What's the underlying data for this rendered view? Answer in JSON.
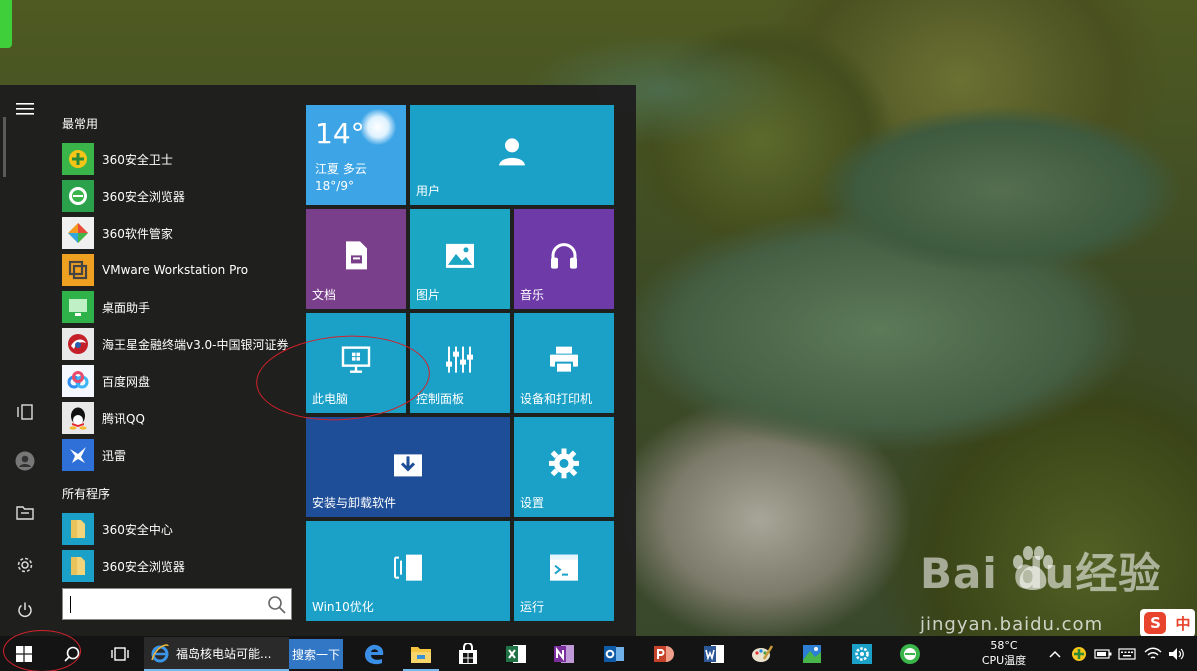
{
  "start_menu": {
    "most_used_heading": "最常用",
    "most_used": [
      {
        "label": "360安全卫士",
        "icon": "360-safeguard-icon",
        "color": "#3ab54a"
      },
      {
        "label": "360安全浏览器",
        "icon": "360-browser-icon",
        "color": "#2aa14a"
      },
      {
        "label": "360软件管家",
        "icon": "360-software-manager-icon",
        "color": "#e8a020"
      },
      {
        "label": "VMware Workstation Pro",
        "icon": "vmware-icon",
        "color": "#f0a020"
      },
      {
        "label": "桌面助手",
        "icon": "desktop-assistant-icon",
        "color": "#2fb24a"
      },
      {
        "label": "海王星金融终端v3.0-中国银河证券",
        "icon": "neptune-finance-icon",
        "color": "#c4202a"
      },
      {
        "label": "百度网盘",
        "icon": "baidu-netdisk-icon",
        "color": "#2f8ef0"
      },
      {
        "label": "腾讯QQ",
        "icon": "qq-icon",
        "color": "#111111"
      },
      {
        "label": "迅雷",
        "icon": "xunlei-icon",
        "color": "#2f6fd8"
      }
    ],
    "all_programs_heading": "所有程序",
    "all_programs": [
      {
        "label": "360安全中心",
        "icon": "folder-icon",
        "color": "#e8c25a"
      },
      {
        "label": "360安全浏览器",
        "icon": "folder-icon",
        "color": "#e8c25a"
      }
    ],
    "search_placeholder": ""
  },
  "tiles": {
    "weather": {
      "temp": "14°",
      "city": "江夏 多云",
      "range": "18°/9°",
      "color": "#3da5e6"
    },
    "items": [
      {
        "key": "user",
        "label": "用户",
        "icon": "user-icon",
        "color": "#1ba1c8"
      },
      {
        "key": "documents",
        "label": "文档",
        "icon": "document-icon",
        "color": "#7a3f8a"
      },
      {
        "key": "pictures",
        "label": "图片",
        "icon": "picture-icon",
        "color": "#1ba6c4"
      },
      {
        "key": "music",
        "label": "音乐",
        "icon": "headphones-icon",
        "color": "#6e3aa8"
      },
      {
        "key": "this_pc",
        "label": "此电脑",
        "icon": "monitor-icon",
        "color": "#1ba1c8"
      },
      {
        "key": "control_panel",
        "label": "控制面板",
        "icon": "sliders-icon",
        "color": "#1ba1c8"
      },
      {
        "key": "devices_printers",
        "label": "设备和打印机",
        "icon": "printer-icon",
        "color": "#1ba1c8"
      },
      {
        "key": "install_uninstall",
        "label": "安装与卸载软件",
        "icon": "download-box-icon",
        "color": "#1f4e99"
      },
      {
        "key": "settings",
        "label": "设置",
        "icon": "gear-icon",
        "color": "#1ba1c8"
      },
      {
        "key": "win10_optimize",
        "label": "Win10优化",
        "icon": "optimize-icon",
        "color": "#1ba1c8"
      },
      {
        "key": "run",
        "label": "运行",
        "icon": "run-icon",
        "color": "#1ba1c8"
      }
    ]
  },
  "taskbar": {
    "browser_title": "福岛核电站可能...",
    "search_button": "搜索一下",
    "pinned": [
      "edge-icon",
      "file-explorer-icon",
      "store-icon",
      "excel-icon",
      "onenote-icon",
      "outlook-icon",
      "powerpoint-icon",
      "word-icon",
      "paint-icon",
      "photos-icon",
      "settings-app-icon",
      "360-app-icon"
    ],
    "cpu_temp_value": "58°C",
    "cpu_temp_label": "CPU温度"
  },
  "watermark": {
    "brand": "Bai  du经验",
    "url": "jingyan.baidu.com"
  },
  "ime": {
    "label": "中"
  }
}
